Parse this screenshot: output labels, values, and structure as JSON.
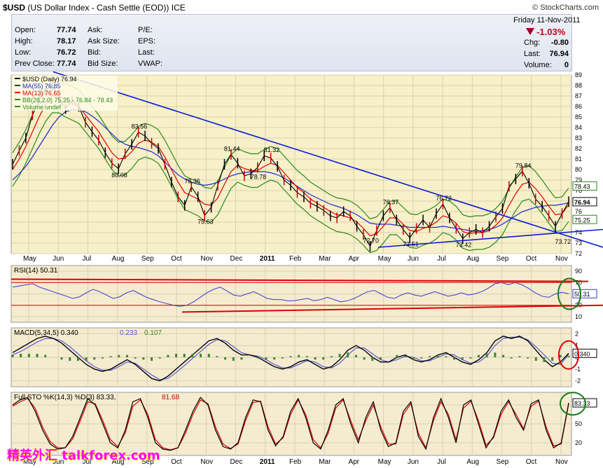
{
  "header": {
    "symbol": "$USD",
    "name": "(US Dollar Index - Cash Settle (EOD))",
    "exchange": "ICE",
    "source": "© StockCharts.com"
  },
  "quote": {
    "date_line": "Friday  11-Nov-2011",
    "pct_change": "-1.03%",
    "change_arrow": "triangle-down-icon",
    "fields": [
      {
        "label": "Open:",
        "value": "77.74"
      },
      {
        "label": "High:",
        "value": "78.17"
      },
      {
        "label": "Low:",
        "value": "76.72"
      },
      {
        "label": "Prev Close:",
        "value": "77.74"
      }
    ],
    "fields2": [
      {
        "label": "Ask:",
        "value": ""
      },
      {
        "label": "Ask Size:",
        "value": ""
      },
      {
        "label": "Bid:",
        "value": ""
      },
      {
        "label": "Bid Size:",
        "value": ""
      }
    ],
    "fields3": [
      {
        "label": "P/E:",
        "value": ""
      },
      {
        "label": "EPS:",
        "value": ""
      },
      {
        "label": "Last:",
        "value": ""
      },
      {
        "label": "VWAP:",
        "value": ""
      }
    ],
    "right": [
      {
        "label": "Chg:",
        "value": "-0.80"
      },
      {
        "label": "Last:",
        "value": "76.94"
      },
      {
        "label": "Volume:",
        "value": "0"
      }
    ]
  },
  "colors": {
    "price_bg": "#f7f0c8",
    "panel_bg": "#f5ecd0",
    "ma55": "#1b2bd0",
    "ma13": "#e00000",
    "bb": "#2a8a1a",
    "trend": "#0a1ad8",
    "red_line": "#e00000",
    "circle_green": "#1a7a1a",
    "circle_red": "#e00000"
  },
  "chart_data": [
    {
      "type": "line",
      "panel": "price",
      "legend": [
        {
          "text": "$USD (Daily) 76.94",
          "color": "#000000"
        },
        {
          "text": "MA(55) 76.85",
          "color": "#1b2bd0"
        },
        {
          "text": "MA(13) 76.65",
          "color": "#e00000"
        },
        {
          "text": "BB(26,2.0) 75.25 - 76.84 - 78.43",
          "color": "#2a8a1a"
        },
        {
          "text": "Volume undef",
          "color": "#2a8a1a"
        }
      ],
      "ylim": [
        72,
        89
      ],
      "yticks": [
        72,
        73,
        74,
        75,
        76,
        77,
        78,
        79,
        80,
        81,
        82,
        83,
        84,
        85,
        86,
        87,
        88,
        89
      ],
      "x_labels": [
        "May",
        "Jun",
        "Jul",
        "Aug",
        "Sep",
        "Oct",
        "Nov",
        "Dec",
        "2011",
        "Feb",
        "Mar",
        "Apr",
        "May",
        "Jun",
        "Jul",
        "Aug",
        "Sep",
        "Oct",
        "Nov"
      ],
      "series": [
        {
          "name": "$USD",
          "values": [
            80.5,
            81.8,
            83.0,
            85.2,
            86.6,
            87.6,
            88.0,
            86.7,
            85.8,
            86.6,
            86.0,
            84.5,
            83.6,
            82.8,
            81.6,
            80.6,
            80.08,
            81.5,
            82.4,
            83.56,
            83.2,
            82.5,
            82.0,
            80.5,
            78.8,
            77.4,
            76.6,
            78.36,
            77.4,
            75.63,
            76.4,
            78.5,
            80.5,
            81.44,
            80.6,
            79.4,
            79.6,
            80.2,
            81.3,
            81.1,
            80.3,
            79.0,
            78.5,
            77.8,
            77.4,
            76.8,
            76.5,
            76.1,
            75.6,
            75.4,
            76.0,
            75.6,
            74.6,
            73.8,
            72.7,
            74.2,
            75.6,
            76.37,
            75.2,
            74.3,
            73.51,
            74.4,
            75.2,
            74.5,
            75.8,
            76.72,
            75.4,
            74.4,
            73.42,
            74.0,
            74.3,
            74.0,
            74.6,
            75.5,
            76.3,
            78.4,
            79.1,
            79.84,
            78.7,
            77.2,
            76.5,
            75.6,
            74.6,
            75.8,
            76.94
          ]
        },
        {
          "name": "MA(55)",
          "values": [
            79.0,
            79.6,
            80.3,
            81.2,
            82.2,
            83.2,
            84.2,
            85.0,
            85.5,
            85.7,
            85.7,
            85.5,
            85.1,
            84.6,
            84.0,
            83.4,
            82.8,
            82.4,
            82.2,
            82.1,
            81.9,
            81.7,
            81.3,
            80.7,
            80.1,
            79.5,
            79.1,
            78.8,
            78.6,
            78.5,
            78.6,
            78.8,
            79.1,
            79.4,
            79.6,
            79.7,
            79.8,
            79.8,
            79.8,
            79.7,
            79.5,
            79.2,
            78.8,
            78.4,
            78.0,
            77.6,
            77.3,
            77.0,
            76.7,
            76.5,
            76.3,
            76.0,
            75.7,
            75.3,
            74.9,
            74.8,
            74.8,
            74.8,
            74.7,
            74.6,
            74.5,
            74.5,
            74.5,
            74.5,
            74.5,
            74.6,
            74.5,
            74.4,
            74.3,
            74.2,
            74.1,
            74.2,
            74.3,
            74.5,
            74.8,
            75.2,
            75.6,
            76.0,
            76.2,
            76.4,
            76.5,
            76.6,
            76.6,
            76.7,
            76.85
          ]
        },
        {
          "name": "MA(13)",
          "values": [
            80.0,
            81.0,
            82.2,
            83.6,
            85.0,
            86.2,
            87.0,
            87.0,
            86.6,
            86.3,
            86.0,
            85.2,
            84.4,
            83.6,
            82.6,
            81.6,
            81.0,
            81.1,
            81.7,
            82.5,
            82.8,
            82.6,
            82.2,
            81.2,
            80.0,
            78.8,
            77.8,
            77.5,
            77.2,
            76.7,
            76.6,
            77.3,
            78.6,
            79.8,
            80.4,
            80.1,
            79.9,
            79.9,
            80.3,
            80.6,
            80.4,
            79.7,
            79.0,
            78.3,
            77.8,
            77.2,
            76.8,
            76.4,
            76.0,
            75.7,
            75.6,
            75.4,
            75.0,
            74.4,
            73.7,
            73.9,
            74.6,
            75.4,
            75.4,
            74.8,
            74.2,
            74.1,
            74.4,
            74.6,
            75.0,
            75.6,
            75.4,
            74.9,
            74.1,
            73.9,
            74.0,
            74.0,
            74.2,
            74.7,
            75.4,
            76.6,
            77.7,
            78.6,
            78.8,
            78.2,
            77.4,
            76.5,
            75.7,
            75.8,
            76.65
          ]
        }
      ],
      "annotations": [
        "83.56",
        "80.08",
        "78.36",
        "75.63",
        "81.44",
        "81.32",
        "78.78",
        "76.37",
        "72.70",
        "73.51",
        "76.72",
        "73.42",
        "79.84",
        "73.72"
      ],
      "right_labels": [
        "78.43",
        "76.94",
        "75.25"
      ]
    },
    {
      "type": "line",
      "panel": "rsi",
      "legend": "RSI(14) 50.31",
      "ylim": [
        0,
        100
      ],
      "yticks": [
        10,
        30,
        50,
        70,
        90
      ],
      "series": [
        {
          "name": "RSI(14)",
          "values": [
            62,
            64,
            66,
            68,
            62,
            58,
            54,
            50,
            46,
            42,
            45,
            52,
            58,
            54,
            48,
            42,
            45,
            52,
            56,
            50,
            44,
            40,
            36,
            33,
            30,
            28,
            30,
            36,
            44,
            52,
            58,
            62,
            55,
            48,
            46,
            50,
            54,
            48,
            42,
            40,
            40,
            38,
            38,
            40,
            42,
            38,
            40,
            44,
            40,
            36,
            38,
            42,
            48,
            54,
            56,
            50,
            44,
            42,
            48,
            52,
            48,
            46,
            50,
            54,
            50,
            46,
            48,
            52,
            48,
            50,
            54,
            60,
            68,
            70,
            66,
            70,
            66,
            60,
            52,
            46,
            44,
            50,
            53,
            50.31
          ]
        }
      ],
      "right_label": "50.31"
    },
    {
      "type": "line",
      "panel": "macd",
      "legend": [
        "MACD(5,34,5) 0.340",
        "0.233",
        "0.107"
      ],
      "ylim": [
        -2.5,
        2.5
      ],
      "yticks": [
        -2,
        -1,
        0,
        1,
        2
      ],
      "series": [
        {
          "name": "MACD",
          "values": [
            0.4,
            0.8,
            1.2,
            1.6,
            1.8,
            1.6,
            1.2,
            0.6,
            0.0,
            -0.6,
            -1.0,
            -1.2,
            -1.0,
            -0.6,
            -0.2,
            -0.6,
            -1.2,
            -1.8,
            -2.0,
            -1.6,
            -1.0,
            -0.4,
            0.2,
            0.8,
            1.4,
            1.6,
            1.2,
            0.6,
            0.2,
            0.2,
            0.0,
            -0.4,
            -0.8,
            -1.0,
            -0.8,
            -0.4,
            -0.2,
            -0.6,
            -1.0,
            -0.8,
            -0.2,
            0.6,
            1.0,
            0.6,
            0.0,
            -0.4,
            -0.4,
            0.0,
            0.2,
            -0.2,
            -0.4,
            -0.2,
            0.2,
            0.4,
            0.0,
            -0.4,
            -0.6,
            -0.2,
            0.4,
            1.4,
            1.8,
            1.6,
            1.8,
            1.4,
            0.6,
            -0.2,
            -0.8,
            -0.4,
            0.34
          ]
        },
        {
          "name": "Signal",
          "values": [
            0.2,
            0.5,
            0.9,
            1.3,
            1.6,
            1.6,
            1.4,
            0.9,
            0.3,
            -0.3,
            -0.8,
            -1.1,
            -1.1,
            -0.8,
            -0.4,
            -0.5,
            -1.0,
            -1.5,
            -1.9,
            -1.8,
            -1.3,
            -0.7,
            -0.1,
            0.5,
            1.1,
            1.5,
            1.4,
            0.9,
            0.4,
            0.2,
            0.1,
            -0.2,
            -0.6,
            -0.9,
            -0.9,
            -0.6,
            -0.3,
            -0.4,
            -0.8,
            -0.9,
            -0.5,
            0.2,
            0.8,
            0.8,
            0.3,
            -0.2,
            -0.4,
            -0.2,
            0.1,
            0.0,
            -0.3,
            -0.3,
            0.0,
            0.3,
            0.2,
            -0.2,
            -0.5,
            -0.4,
            0.1,
            1.0,
            1.6,
            1.7,
            1.7,
            1.5,
            0.9,
            0.2,
            -0.5,
            -0.6,
            0.233
          ]
        }
      ],
      "right_label": "0.340"
    },
    {
      "type": "line",
      "panel": "sto",
      "legend": [
        "Full STO %K(14,3) %D(3) 83.33,",
        "81.68"
      ],
      "ylim": [
        0,
        100
      ],
      "yticks": [
        20,
        50,
        80
      ],
      "series": [
        {
          "name": "%K",
          "values": [
            80,
            88,
            92,
            70,
            40,
            18,
            10,
            12,
            30,
            60,
            90,
            80,
            50,
            20,
            12,
            40,
            85,
            90,
            60,
            20,
            10,
            8,
            12,
            40,
            70,
            92,
            80,
            40,
            14,
            10,
            20,
            60,
            88,
            85,
            40,
            15,
            30,
            70,
            90,
            60,
            20,
            10,
            40,
            80,
            90,
            50,
            20,
            60,
            85,
            40,
            14,
            20,
            70,
            85,
            30,
            10,
            60,
            90,
            60,
            20,
            80,
            88,
            50,
            12,
            30,
            70,
            88,
            60,
            40,
            82,
            88,
            40,
            12,
            20,
            83.33
          ]
        },
        {
          "name": "%D",
          "values": [
            78,
            85,
            90,
            75,
            45,
            22,
            12,
            12,
            26,
            55,
            85,
            82,
            55,
            25,
            14,
            36,
            78,
            88,
            65,
            25,
            12,
            9,
            12,
            35,
            65,
            88,
            82,
            45,
            18,
            11,
            18,
            55,
            84,
            86,
            45,
            18,
            28,
            65,
            88,
            65,
            25,
            12,
            35,
            75,
            88,
            55,
            25,
            55,
            80,
            45,
            18,
            18,
            65,
            82,
            35,
            12,
            55,
            85,
            65,
            25,
            75,
            86,
            55,
            16,
            28,
            65,
            85,
            65,
            42,
            78,
            86,
            45,
            15,
            18,
            81.68
          ]
        }
      ],
      "right_label": "83.33"
    }
  ],
  "watermark": "精英外汇 talkforex.com"
}
